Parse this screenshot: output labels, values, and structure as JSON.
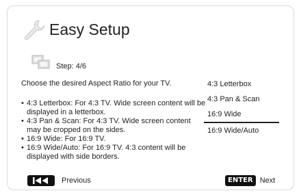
{
  "header": {
    "title": "Easy Setup",
    "icon": "wrench-icon"
  },
  "step": {
    "label": "Step: 4/6",
    "icon": "display-step-icon"
  },
  "prompt": "Choose the desired Aspect Ratio for your TV.",
  "descriptions": [
    "4:3 Letterbox: For 4:3 TV. Wide screen content will be displayed in a letterbox.",
    "4:3 Pan & Scan: For 4:3 TV. Wide screen content may be cropped on the sides.",
    "16:9 Wide: For 16:9 TV.",
    "16:9 Wide/Auto: For 16:9 TV. 4:3 content will be displayed with side borders."
  ],
  "options": {
    "items": [
      "4:3 Letterbox",
      "4:3 Pan & Scan",
      "16:9 Wide",
      "16:9 Wide/Auto"
    ],
    "selected": "16:9 Wide"
  },
  "footer": {
    "previous_label": "Previous",
    "previous_icon": "skip-back-icon",
    "enter_key": "ENTER",
    "next_label": "Next"
  }
}
